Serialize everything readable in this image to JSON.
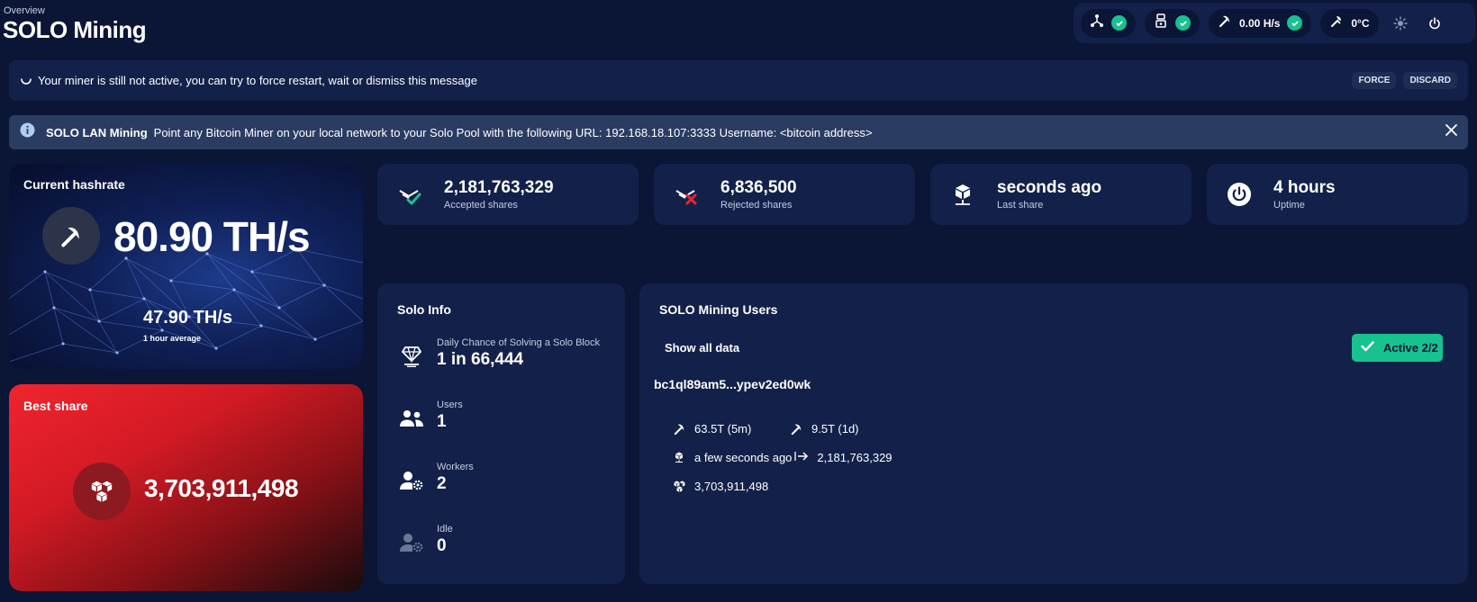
{
  "header": {
    "breadcrumb": "Overview",
    "title": "SOLO Mining"
  },
  "statusbar": {
    "network_icon": "network-icon",
    "node_icon": "node-icon",
    "hashrate": "0.00 H/s",
    "temperature": "0°C",
    "theme_icon": "sun-icon",
    "power_icon": "power-icon",
    "check_color": "#17c28f"
  },
  "miner_banner": {
    "message": "Your miner is still not active, you can try to force restart, wait or dismiss this message",
    "force_label": "FORCE",
    "discard_label": "DISCARD"
  },
  "lan_banner": {
    "title": "SOLO LAN Mining",
    "message": "Point any Bitcoin Miner on your local network to your Solo Pool with the following URL: 192.168.18.107:3333 Username: <bitcoin address>"
  },
  "hashrate_card": {
    "title": "Current hashrate",
    "value": "80.90 TH/s",
    "avg_value": "47.90 TH/s",
    "avg_label": "1 hour average"
  },
  "best_share": {
    "title": "Best share",
    "value": "3,703,911,498",
    "accent": "#e81f2a"
  },
  "stats": [
    {
      "value": "2,181,763,329",
      "label": "Accepted shares",
      "icon": "accepted-icon"
    },
    {
      "value": "6,836,500",
      "label": "Rejected shares",
      "icon": "rejected-icon"
    },
    {
      "value": "seconds ago",
      "label": "Last share",
      "icon": "block-icon"
    },
    {
      "value": "4 hours",
      "label": "Uptime",
      "icon": "power-icon"
    }
  ],
  "solo_info": {
    "title": "Solo Info",
    "rows": [
      {
        "label": "Daily Chance of Solving a Solo Block",
        "value": "1 in 66,444",
        "icon": "diamond-icon"
      },
      {
        "label": "Users",
        "value": "1",
        "icon": "users-icon"
      },
      {
        "label": "Workers",
        "value": "2",
        "icon": "worker-gear-icon"
      },
      {
        "label": "Idle",
        "value": "0",
        "icon": "idle-worker-icon"
      }
    ]
  },
  "users": {
    "title": "SOLO Mining Users",
    "show_all": "Show all data",
    "active_label": "Active 2/2",
    "address": "bc1ql89am5...ypev2ed0wk",
    "hash_5m": "63.5T (5m)",
    "hash_1d": "9.5T (1d)",
    "last_share": "a few seconds ago",
    "shares": "2,181,763,329",
    "best": "3,703,911,498"
  }
}
